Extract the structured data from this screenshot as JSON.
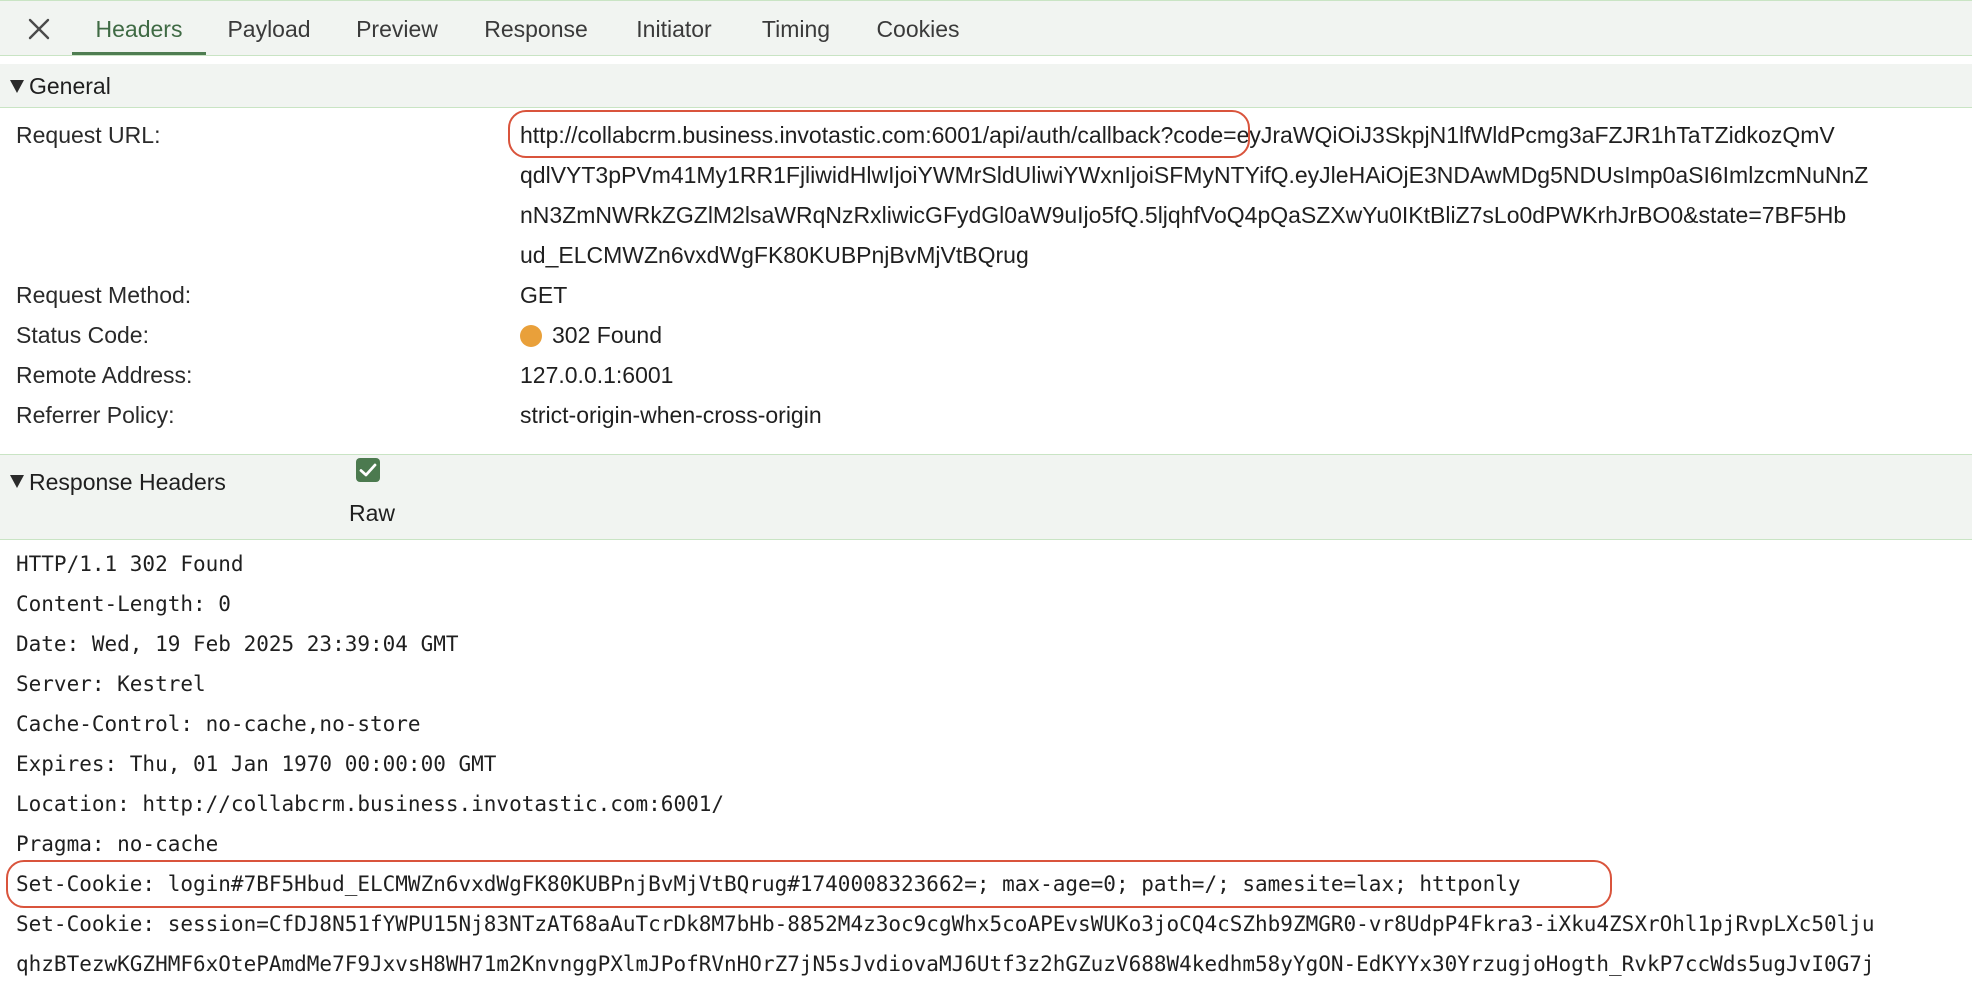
{
  "tabs": [
    {
      "label": "Headers",
      "active": true
    },
    {
      "label": "Payload"
    },
    {
      "label": "Preview"
    },
    {
      "label": "Response"
    },
    {
      "label": "Initiator"
    },
    {
      "label": "Timing"
    },
    {
      "label": "Cookies"
    }
  ],
  "general": {
    "title": "General",
    "request_url_label": "Request URL:",
    "request_url_lines": [
      "http://collabcrm.business.invotastic.com:6001/api/auth/callback?code=eyJraWQiOiJ3SkpjN1lfWldPcmg3aFZJR1hTaTZidkozQmV",
      "qdlVYT3pPVm41My1RR1FjliwidHlwIjoiYWMrSldUliwiYWxnIjoiSFMyNTYifQ.eyJleHAiOjE3NDAwMDg5NDUsImp0aSI6ImlzcmNuNnZ",
      "nN3ZmNWRkZGZlM2lsaWRqNzRxliwicGFydGl0aW9uIjo5fQ.5ljqhfVoQ4pQaSZXwYu0IKtBliZ7sLo0dPWKrhJrBO0&state=7BF5Hb",
      "ud_ELCMWZn6vxdWgFK80KUBPnjBvMjVtBQrug"
    ],
    "request_method_label": "Request Method:",
    "request_method": "GET",
    "status_code_label": "Status Code:",
    "status_code": "302 Found",
    "status_color": "#e9a03a",
    "remote_address_label": "Remote Address:",
    "remote_address": "127.0.0.1:6001",
    "referrer_policy_label": "Referrer Policy:",
    "referrer_policy": "strict-origin-when-cross-origin"
  },
  "response_headers": {
    "title": "Response Headers",
    "raw_label": "Raw",
    "raw_checked": true,
    "lines": [
      "HTTP/1.1 302 Found",
      "Content-Length: 0",
      "Date: Wed, 19 Feb 2025 23:39:04 GMT",
      "Server: Kestrel",
      "Cache-Control: no-cache,no-store",
      "Expires: Thu, 01 Jan 1970 00:00:00 GMT",
      "Location: http://collabcrm.business.invotastic.com:6001/",
      "Pragma: no-cache",
      "Set-Cookie: login#7BF5Hbud_ELCMWZn6vxdWgFK80KUBPnjBvMjVtBQrug#1740008323662=; max-age=0; path=/; samesite=lax; httponly",
      "Set-Cookie: session=CfDJ8N51fYWPU15Nj83NTzAT68aAuTcrDk8M7bHb-8852M4z3oc9cgWhx5coAPEvsWUKo3joCQ4cSZhb9ZMGR0-vr8UdpP4Fkra3-iXku4ZSXrOhl1pjRvpLXc50lju",
      "qhzBTezwKGZHMF6xOtePAmdMe7F9JxvsH8WH71m2KnvnggPXlmJPofRVnHOrZ7jN5sJvdiovaMJ6Utf3z2hGZuzV688W4kedhm58yYgON-EdKYYx30YrzugjoHogth_RvkP7ccWds5ugJvI0G7j"
    ]
  },
  "colors": {
    "accent": "#4f7d52",
    "highlight": "#d9543c",
    "section_bg": "#f1f4f1"
  }
}
